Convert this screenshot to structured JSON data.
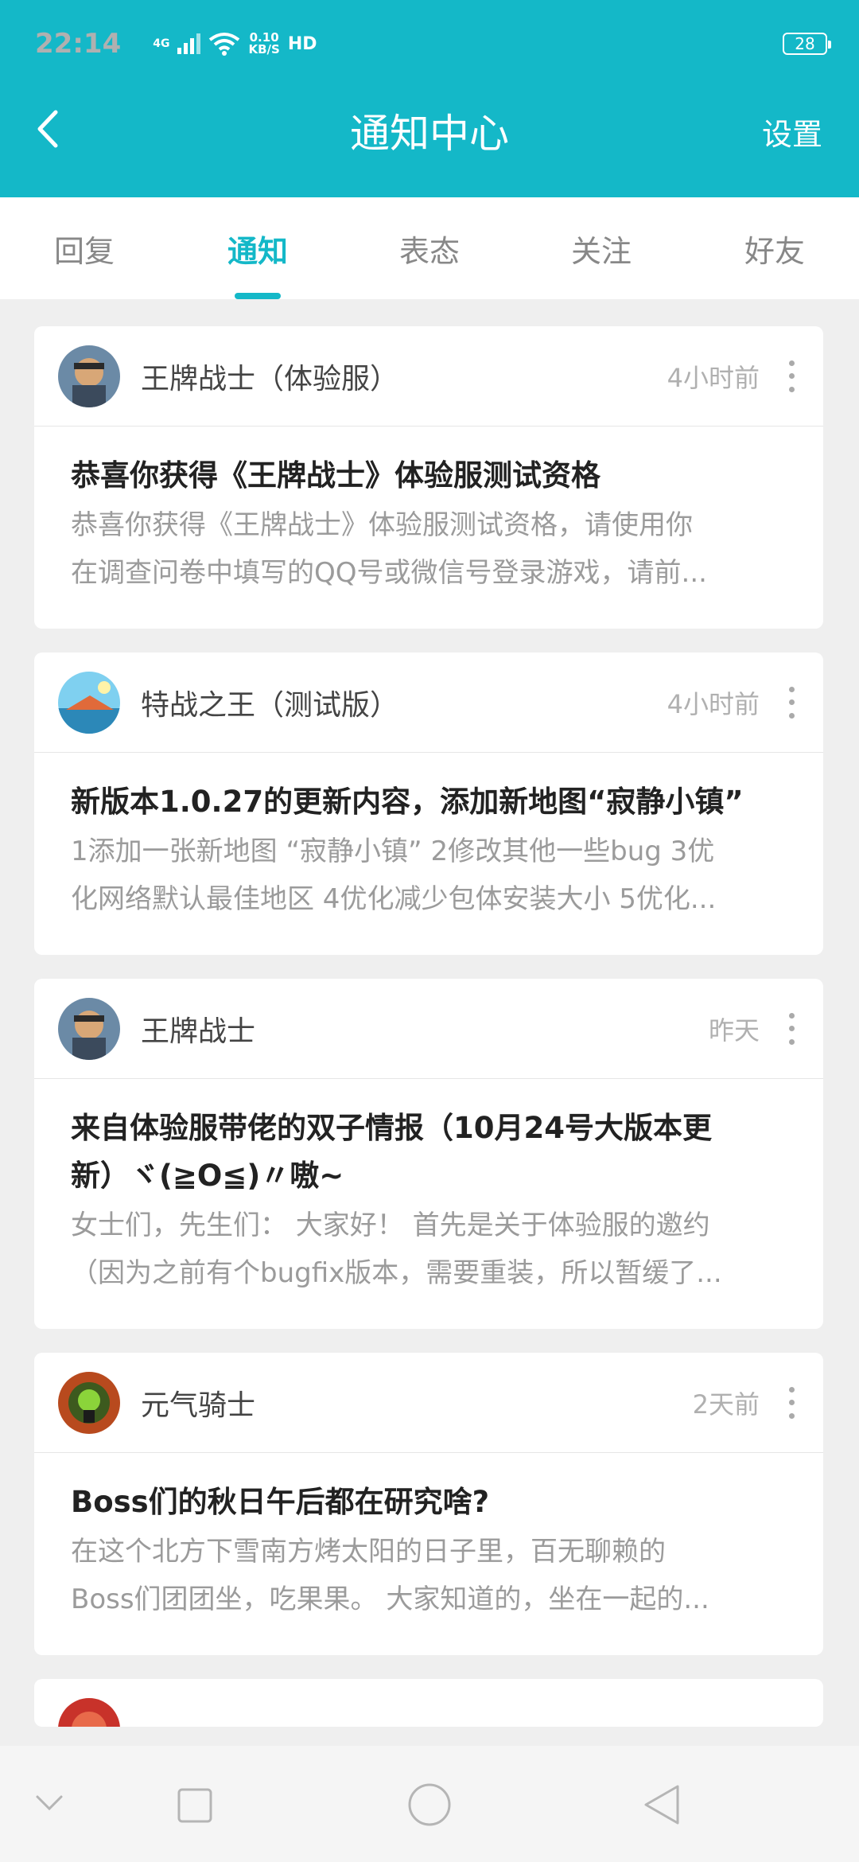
{
  "status_bar": {
    "time": "22:14",
    "network": "4G",
    "speed_value": "0.10",
    "speed_unit": "KB/S",
    "hd": "HD",
    "battery": "28"
  },
  "header": {
    "title": "通知中心",
    "settings_label": "设置"
  },
  "tabs": [
    {
      "label": "回复",
      "active": false
    },
    {
      "label": "通知",
      "active": true
    },
    {
      "label": "表态",
      "active": false
    },
    {
      "label": "关注",
      "active": false
    },
    {
      "label": "好友",
      "active": false
    }
  ],
  "notifications": [
    {
      "source": "王牌战士（体验服）",
      "time": "4小时前",
      "title": "恭喜你获得《王牌战士》体验服测试资格",
      "summary_line1": "恭喜你获得《王牌战士》体验服测试资格，请使用你",
      "summary_line2": "在调查问卷中填写的QQ号或微信号登录游戏，请前..."
    },
    {
      "source": "特战之王（测试版）",
      "time": "4小时前",
      "title": "新版本1.0.27的更新内容，添加新地图“寂静小镇”",
      "summary_line1": "1添加一张新地图 “寂静小镇” 2修改其他一些bug 3优",
      "summary_line2": "化网络默认最佳地区 4优化减少包体安装大小 5优化..."
    },
    {
      "source": "王牌战士",
      "time": "昨天",
      "title_line1": "来自体验服带佬的双子情报（10月24号大版本更",
      "title_line2": "新）ヾ(≧O≦)〃嗷~",
      "summary_line1": "女士们，先生们： 大家好！ 首先是关于体验服的邀约",
      "summary_line2": "（因为之前有个bugfix版本，需要重装，所以暂缓了..."
    },
    {
      "source": "元气骑士",
      "time": "2天前",
      "title": "Boss们的秋日午后都在研究啥?",
      "summary_line1": "在这个北方下雪南方烤太阳的日子里，百无聊赖的",
      "summary_line2": "Boss们团团坐，吃果果。 大家知道的，坐在一起的..."
    }
  ]
}
